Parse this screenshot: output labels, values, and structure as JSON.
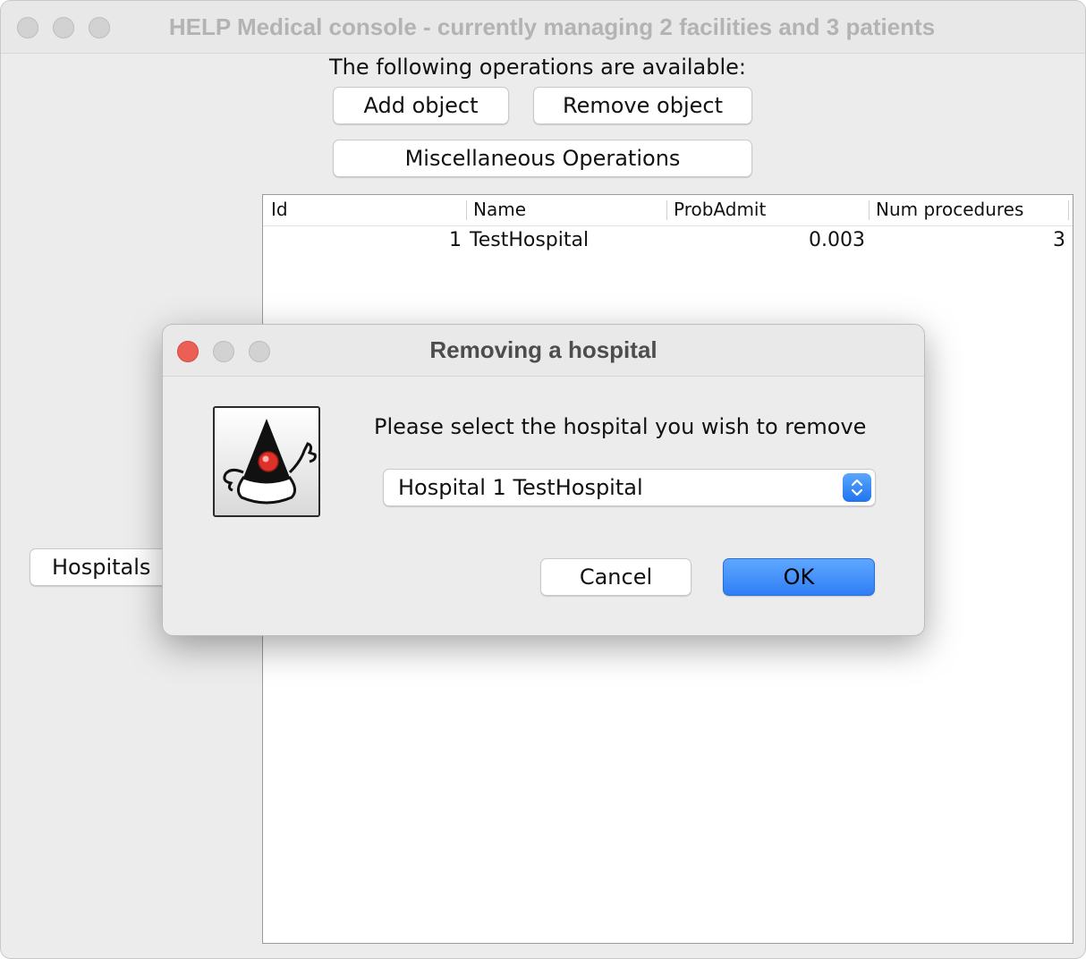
{
  "main_window": {
    "title": "HELP Medical console - currently managing 2 facilities and 3 patients",
    "operations_label": "The following operations are available:",
    "buttons": {
      "add": "Add object",
      "remove": "Remove object",
      "misc": "Miscellaneous Operations",
      "hospitals": "Hospitals"
    },
    "table": {
      "columns": [
        "Id",
        "Name",
        "ProbAdmit",
        "Num procedures"
      ],
      "rows": [
        [
          "1",
          "TestHospital",
          "0.003",
          "3"
        ]
      ]
    }
  },
  "dialog": {
    "title": "Removing a hospital",
    "message": "Please select the hospital you wish to remove",
    "selected_option": "Hospital 1 TestHospital",
    "cancel_label": "Cancel",
    "ok_label": "OK"
  },
  "colors": {
    "close_red": "#ec5f57",
    "accent_blue": "#2f7ef5",
    "inactive_light": "#d2d2d2"
  }
}
